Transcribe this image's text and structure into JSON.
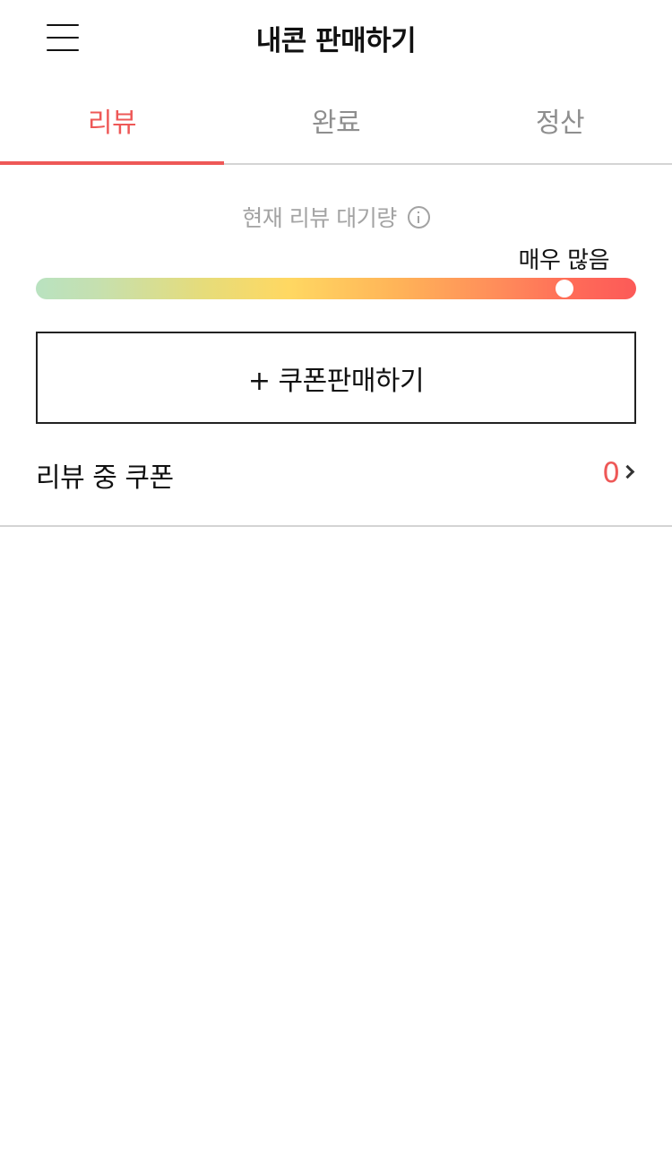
{
  "header": {
    "title": "내콘 판매하기",
    "menu_icon": "hamburger-menu-icon"
  },
  "tabs": [
    {
      "label": "리뷰",
      "active": true
    },
    {
      "label": "완료",
      "active": false
    },
    {
      "label": "정산",
      "active": false
    }
  ],
  "queue": {
    "label": "현재 리뷰 대기량",
    "info_icon": "info-circle-icon",
    "level_text": "매우 많음",
    "level_fraction": 0.88
  },
  "sell_button": {
    "label": "+ 쿠폰판매하기"
  },
  "coupon_row": {
    "label": "리뷰 중 쿠폰",
    "count": "0",
    "chevron_icon": "chevron-right-icon"
  },
  "colors": {
    "accent": "#ee5857",
    "muted_text": "#a3a3a3",
    "divider": "#d4d4d4"
  }
}
